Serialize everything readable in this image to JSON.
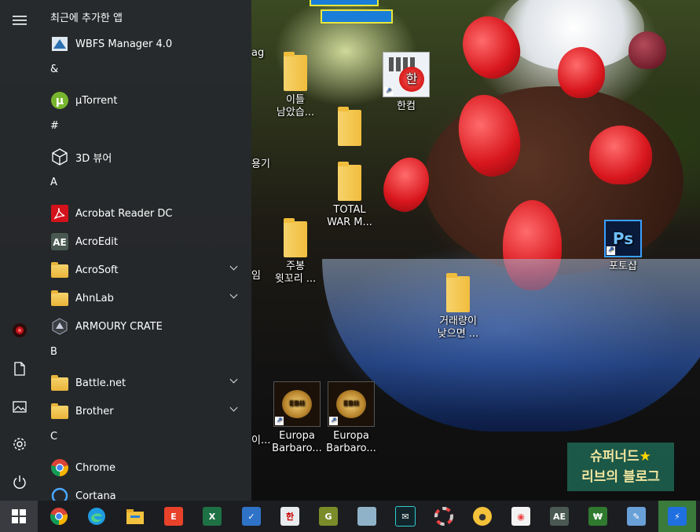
{
  "start_menu": {
    "section_recent": "최근에 추가한 앱",
    "groups": [
      {
        "letter": "&"
      },
      {
        "letter": "#"
      },
      {
        "letter": "A"
      },
      {
        "letter": "B"
      },
      {
        "letter": "C"
      }
    ],
    "apps": {
      "wbfs": "WBFS Manager 4.0",
      "utorrent": "µTorrent",
      "viewer3d": "3D 뷰어",
      "acrobat": "Acrobat Reader DC",
      "acroedit": "AcroEdit",
      "acrosoft": "AcroSoft",
      "ahnlab": "AhnLab",
      "armoury": "ARMOURY CRATE",
      "battlenet": "Battle.net",
      "brother": "Brother",
      "chrome": "Chrome",
      "cortana": "Cortana"
    },
    "rail_icons": [
      "hamburger-icon",
      "armoury-icon",
      "document-icon",
      "pictures-icon",
      "settings-icon",
      "power-icon"
    ]
  },
  "desktop": {
    "icons": {
      "folder1": "이틀\n남았습...",
      "folder2": "...",
      "total_war": "TOTAL\nWAR M...",
      "jubong": "주봉\n윗꼬리 ...",
      "hancom": "한컴",
      "volume": "거래량이\n낮으면 ...",
      "photoshop": "포토샵",
      "europa1": "Europa\nBarbaro...",
      "europa2": "Europa\nBarbaro..."
    },
    "partial_labels": {
      "ag": "ag",
      "gi": "용기",
      "im": "임",
      "i": "이..."
    },
    "watermark": {
      "line1": "슈퍼너드",
      "star": "★",
      "line2": "리브의 블로그"
    }
  },
  "taskbar": {
    "items": [
      "start",
      "chrome",
      "edge",
      "file-explorer",
      "app-red",
      "excel",
      "checklist",
      "hancom",
      "app-green",
      "app-tile",
      "app-dark",
      "app-colorwheel",
      "app-palette",
      "app-camera",
      "acroedit",
      "app-money",
      "app-brush",
      "app-blue"
    ]
  },
  "colors": {
    "start_bg": "#26292c",
    "taskbar_bg": "#1c1d21",
    "accent": "#1a7ed8"
  }
}
